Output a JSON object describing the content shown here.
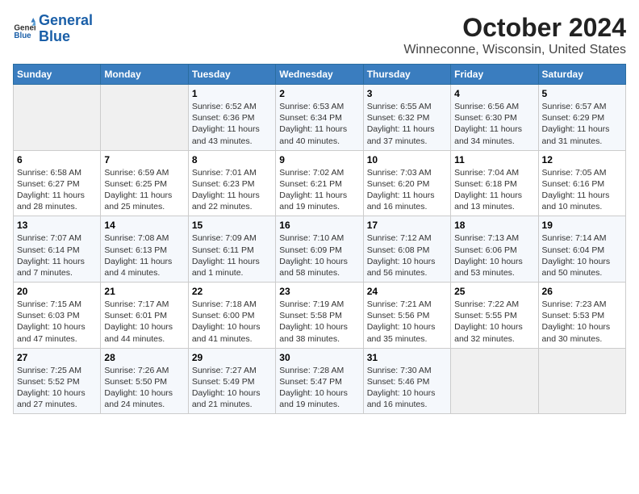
{
  "header": {
    "logo_line1": "General",
    "logo_line2": "Blue",
    "title": "October 2024",
    "subtitle": "Winneconne, Wisconsin, United States"
  },
  "days_of_week": [
    "Sunday",
    "Monday",
    "Tuesday",
    "Wednesday",
    "Thursday",
    "Friday",
    "Saturday"
  ],
  "weeks": [
    [
      {
        "num": "",
        "detail": ""
      },
      {
        "num": "",
        "detail": ""
      },
      {
        "num": "1",
        "detail": "Sunrise: 6:52 AM\nSunset: 6:36 PM\nDaylight: 11 hours\nand 43 minutes."
      },
      {
        "num": "2",
        "detail": "Sunrise: 6:53 AM\nSunset: 6:34 PM\nDaylight: 11 hours\nand 40 minutes."
      },
      {
        "num": "3",
        "detail": "Sunrise: 6:55 AM\nSunset: 6:32 PM\nDaylight: 11 hours\nand 37 minutes."
      },
      {
        "num": "4",
        "detail": "Sunrise: 6:56 AM\nSunset: 6:30 PM\nDaylight: 11 hours\nand 34 minutes."
      },
      {
        "num": "5",
        "detail": "Sunrise: 6:57 AM\nSunset: 6:29 PM\nDaylight: 11 hours\nand 31 minutes."
      }
    ],
    [
      {
        "num": "6",
        "detail": "Sunrise: 6:58 AM\nSunset: 6:27 PM\nDaylight: 11 hours\nand 28 minutes."
      },
      {
        "num": "7",
        "detail": "Sunrise: 6:59 AM\nSunset: 6:25 PM\nDaylight: 11 hours\nand 25 minutes."
      },
      {
        "num": "8",
        "detail": "Sunrise: 7:01 AM\nSunset: 6:23 PM\nDaylight: 11 hours\nand 22 minutes."
      },
      {
        "num": "9",
        "detail": "Sunrise: 7:02 AM\nSunset: 6:21 PM\nDaylight: 11 hours\nand 19 minutes."
      },
      {
        "num": "10",
        "detail": "Sunrise: 7:03 AM\nSunset: 6:20 PM\nDaylight: 11 hours\nand 16 minutes."
      },
      {
        "num": "11",
        "detail": "Sunrise: 7:04 AM\nSunset: 6:18 PM\nDaylight: 11 hours\nand 13 minutes."
      },
      {
        "num": "12",
        "detail": "Sunrise: 7:05 AM\nSunset: 6:16 PM\nDaylight: 11 hours\nand 10 minutes."
      }
    ],
    [
      {
        "num": "13",
        "detail": "Sunrise: 7:07 AM\nSunset: 6:14 PM\nDaylight: 11 hours\nand 7 minutes."
      },
      {
        "num": "14",
        "detail": "Sunrise: 7:08 AM\nSunset: 6:13 PM\nDaylight: 11 hours\nand 4 minutes."
      },
      {
        "num": "15",
        "detail": "Sunrise: 7:09 AM\nSunset: 6:11 PM\nDaylight: 11 hours\nand 1 minute."
      },
      {
        "num": "16",
        "detail": "Sunrise: 7:10 AM\nSunset: 6:09 PM\nDaylight: 10 hours\nand 58 minutes."
      },
      {
        "num": "17",
        "detail": "Sunrise: 7:12 AM\nSunset: 6:08 PM\nDaylight: 10 hours\nand 56 minutes."
      },
      {
        "num": "18",
        "detail": "Sunrise: 7:13 AM\nSunset: 6:06 PM\nDaylight: 10 hours\nand 53 minutes."
      },
      {
        "num": "19",
        "detail": "Sunrise: 7:14 AM\nSunset: 6:04 PM\nDaylight: 10 hours\nand 50 minutes."
      }
    ],
    [
      {
        "num": "20",
        "detail": "Sunrise: 7:15 AM\nSunset: 6:03 PM\nDaylight: 10 hours\nand 47 minutes."
      },
      {
        "num": "21",
        "detail": "Sunrise: 7:17 AM\nSunset: 6:01 PM\nDaylight: 10 hours\nand 44 minutes."
      },
      {
        "num": "22",
        "detail": "Sunrise: 7:18 AM\nSunset: 6:00 PM\nDaylight: 10 hours\nand 41 minutes."
      },
      {
        "num": "23",
        "detail": "Sunrise: 7:19 AM\nSunset: 5:58 PM\nDaylight: 10 hours\nand 38 minutes."
      },
      {
        "num": "24",
        "detail": "Sunrise: 7:21 AM\nSunset: 5:56 PM\nDaylight: 10 hours\nand 35 minutes."
      },
      {
        "num": "25",
        "detail": "Sunrise: 7:22 AM\nSunset: 5:55 PM\nDaylight: 10 hours\nand 32 minutes."
      },
      {
        "num": "26",
        "detail": "Sunrise: 7:23 AM\nSunset: 5:53 PM\nDaylight: 10 hours\nand 30 minutes."
      }
    ],
    [
      {
        "num": "27",
        "detail": "Sunrise: 7:25 AM\nSunset: 5:52 PM\nDaylight: 10 hours\nand 27 minutes."
      },
      {
        "num": "28",
        "detail": "Sunrise: 7:26 AM\nSunset: 5:50 PM\nDaylight: 10 hours\nand 24 minutes."
      },
      {
        "num": "29",
        "detail": "Sunrise: 7:27 AM\nSunset: 5:49 PM\nDaylight: 10 hours\nand 21 minutes."
      },
      {
        "num": "30",
        "detail": "Sunrise: 7:28 AM\nSunset: 5:47 PM\nDaylight: 10 hours\nand 19 minutes."
      },
      {
        "num": "31",
        "detail": "Sunrise: 7:30 AM\nSunset: 5:46 PM\nDaylight: 10 hours\nand 16 minutes."
      },
      {
        "num": "",
        "detail": ""
      },
      {
        "num": "",
        "detail": ""
      }
    ]
  ]
}
